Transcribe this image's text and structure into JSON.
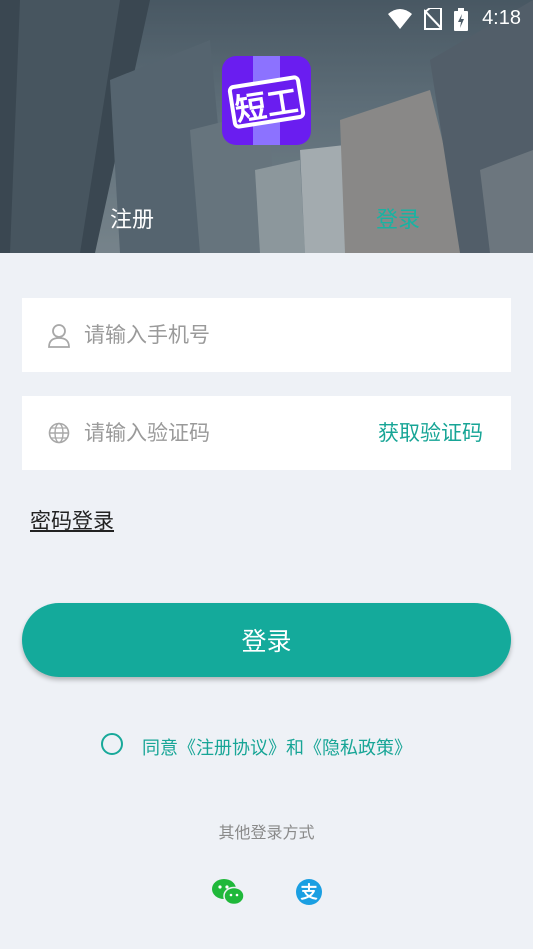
{
  "status_bar": {
    "time": "4:18"
  },
  "header": {
    "logo_text": "短工",
    "tabs": [
      {
        "label": "注册",
        "active": false
      },
      {
        "label": "登录",
        "active": true
      }
    ]
  },
  "form": {
    "phone_placeholder": "请输入手机号",
    "code_placeholder": "请输入验证码",
    "get_code_label": "获取验证码",
    "password_login_label": "密码登录",
    "login_button_label": "登录"
  },
  "agreement": {
    "text": "同意《注册协议》和《隐私政策》",
    "checked": false
  },
  "other_login": {
    "title": "其他登录方式",
    "methods": [
      {
        "icon": "wechat-icon"
      },
      {
        "icon": "alipay-icon"
      }
    ]
  },
  "colors": {
    "accent": "#14aa9b",
    "logo_bg": "#6a1df0",
    "page_bg": "#eef1f6"
  }
}
